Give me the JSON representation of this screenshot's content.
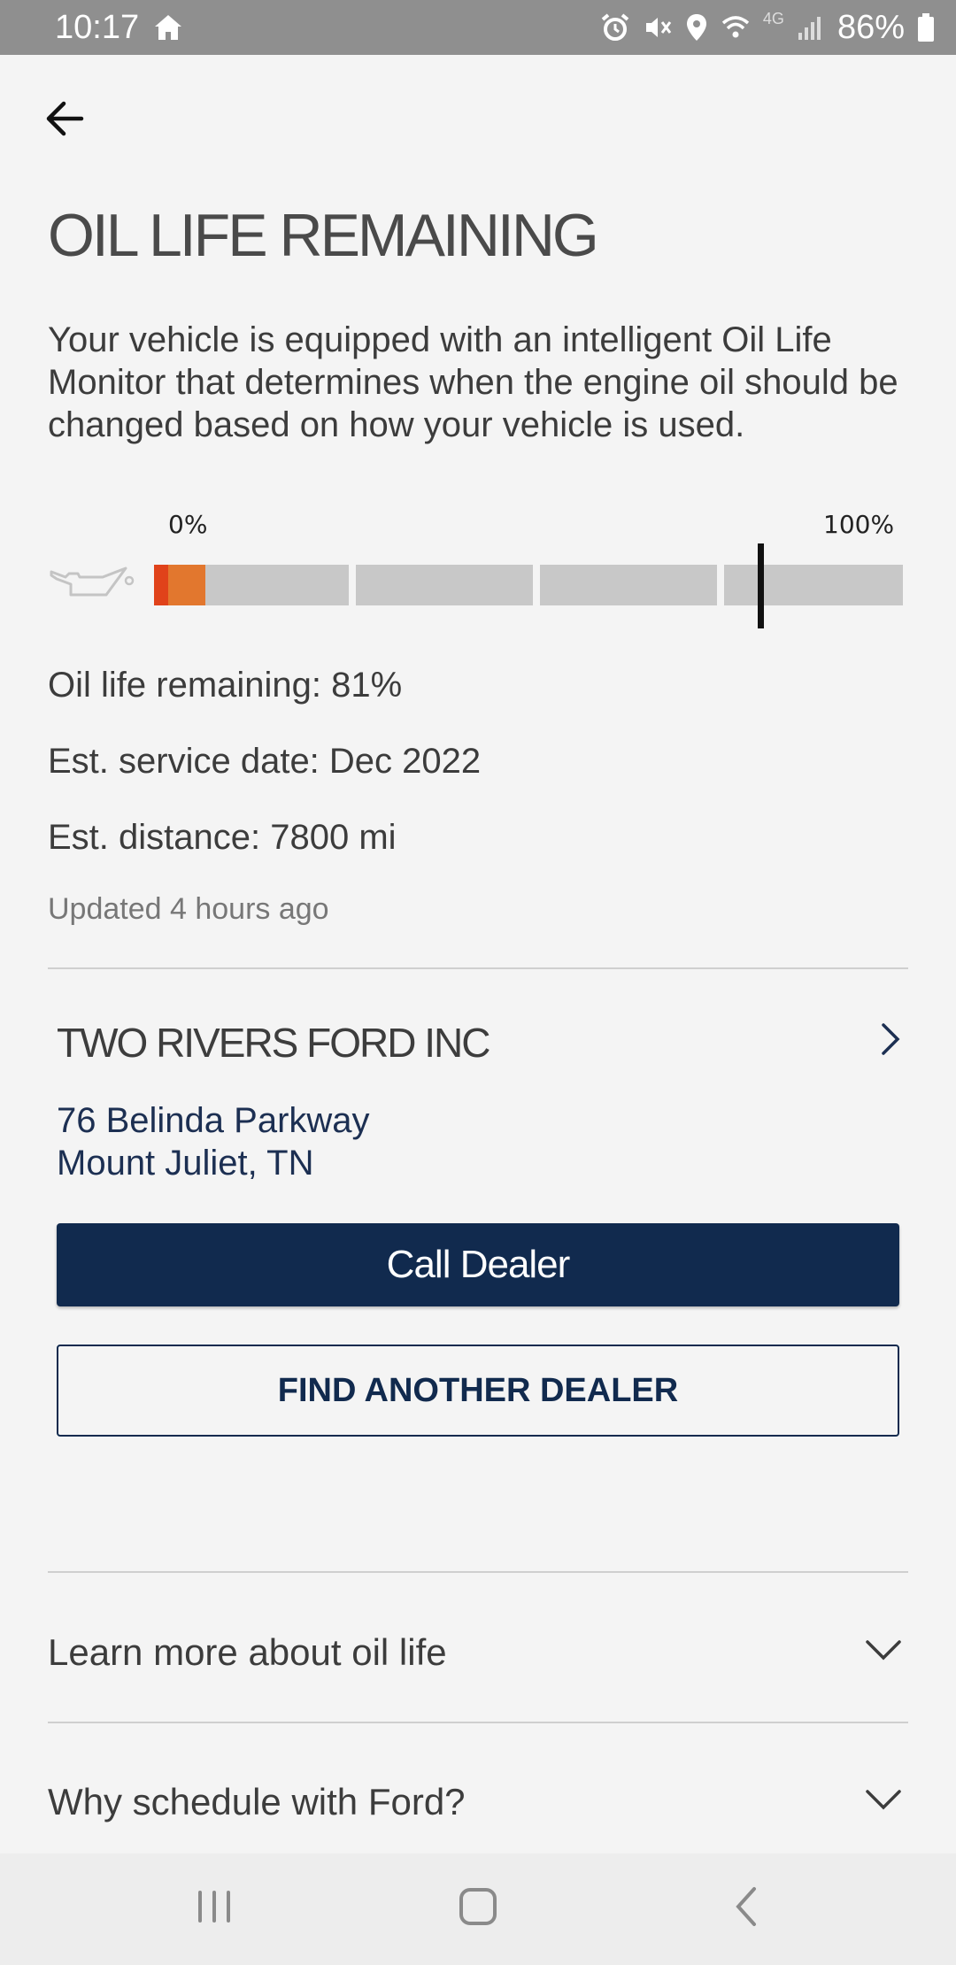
{
  "status_bar": {
    "time": "10:17",
    "battery": "86%",
    "network": "4G"
  },
  "header": {
    "back_icon": "arrow-left-icon",
    "title": "OIL LIFE REMAINING"
  },
  "description": "Your vehicle is equipped with an intelligent Oil Life Monitor that determines when the engine oil should be changed based on how your vehicle is used.",
  "gauge": {
    "label_min": "0%",
    "label_max": "100%",
    "icon": "oil-can-icon",
    "marker_percent": 81,
    "colors": {
      "empty": "#c8c8c8",
      "low": "#e0421a",
      "fill": "#e2772e",
      "marker": "#111111"
    }
  },
  "info": {
    "oil_life": "Oil life remaining: 81%",
    "service_date": "Est. service date: Dec 2022",
    "distance": "Est. distance: 7800 mi",
    "updated": "Updated 4 hours ago"
  },
  "dealer": {
    "name": "TWO RIVERS FORD INC",
    "address_line1": "76 Belinda Parkway",
    "address_line2": "Mount Juliet, TN",
    "call_label": "Call Dealer",
    "find_label": "FIND ANOTHER DEALER"
  },
  "accordions": [
    {
      "label": "Learn more about oil life",
      "icon": "chevron-down-icon"
    },
    {
      "label": "Why schedule with Ford?",
      "icon": "chevron-down-icon"
    }
  ],
  "colors": {
    "brand_navy": "#112a4e",
    "background": "#f4f4f4",
    "status_bar": "#8f8f8f"
  }
}
